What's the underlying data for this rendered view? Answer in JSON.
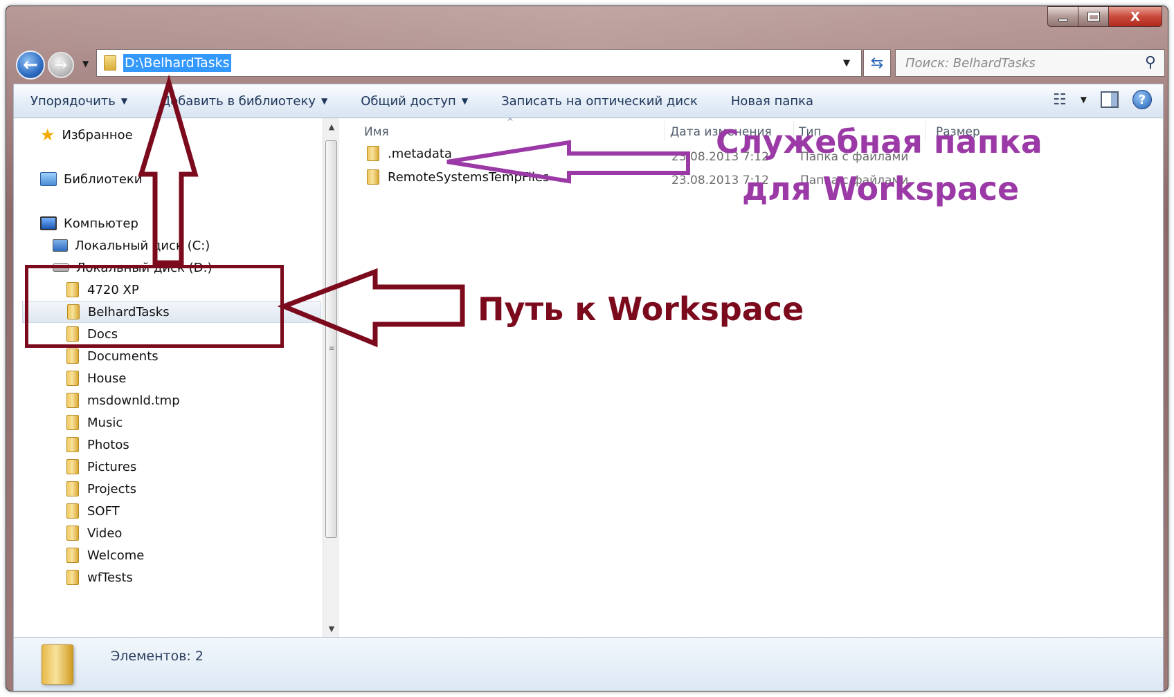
{
  "window": {
    "buttons": {
      "minimize": "–",
      "maximize": "□",
      "close": "X"
    }
  },
  "nav": {
    "address": "D:\\BelhardTasks",
    "search_placeholder": "Поиск: BelhardTasks"
  },
  "toolbar": {
    "items": [
      {
        "label": "Упорядочить",
        "has_dropdown": true
      },
      {
        "label": "Добавить в библиотеку",
        "has_dropdown": true
      },
      {
        "label": "Общий доступ",
        "has_dropdown": true
      },
      {
        "label": "Записать на оптический диск",
        "has_dropdown": false
      },
      {
        "label": "Новая папка",
        "has_dropdown": false
      }
    ],
    "help_label": "?"
  },
  "sidebar": {
    "favorites": "Избранное",
    "libraries": "Библиотеки",
    "computer": "Компьютер",
    "drive_c": "Локальный диск (C:)",
    "drive_d": "Локальный диск (D:)",
    "folders": [
      "4720 XP",
      "BelhardTasks",
      "Docs",
      "Documents",
      "House",
      "msdownld.tmp",
      "Music",
      "Photos",
      "Pictures",
      "Projects",
      "SOFT",
      "Video",
      "Welcome",
      "wfTests"
    ],
    "selected": "BelhardTasks"
  },
  "list": {
    "headers": {
      "name": "Имя",
      "date": "Дата изменения",
      "type": "Тип",
      "size": "Размер"
    },
    "rows": [
      {
        "name": ".metadata",
        "date": "23.08.2013 7:12",
        "type": "Папка с файлами"
      },
      {
        "name": "RemoteSystemsTempFiles",
        "date": "23.08.2013 7:12",
        "type": "Папка с файлами"
      }
    ]
  },
  "status": {
    "text": "Элементов: 2"
  },
  "annotations": {
    "path_label": "Путь к Workspace",
    "service_line1": "Служебная папка",
    "service_line2": "для Workspace",
    "colors": {
      "path": "#7b0a1d",
      "service": "#9b3aa6"
    }
  }
}
